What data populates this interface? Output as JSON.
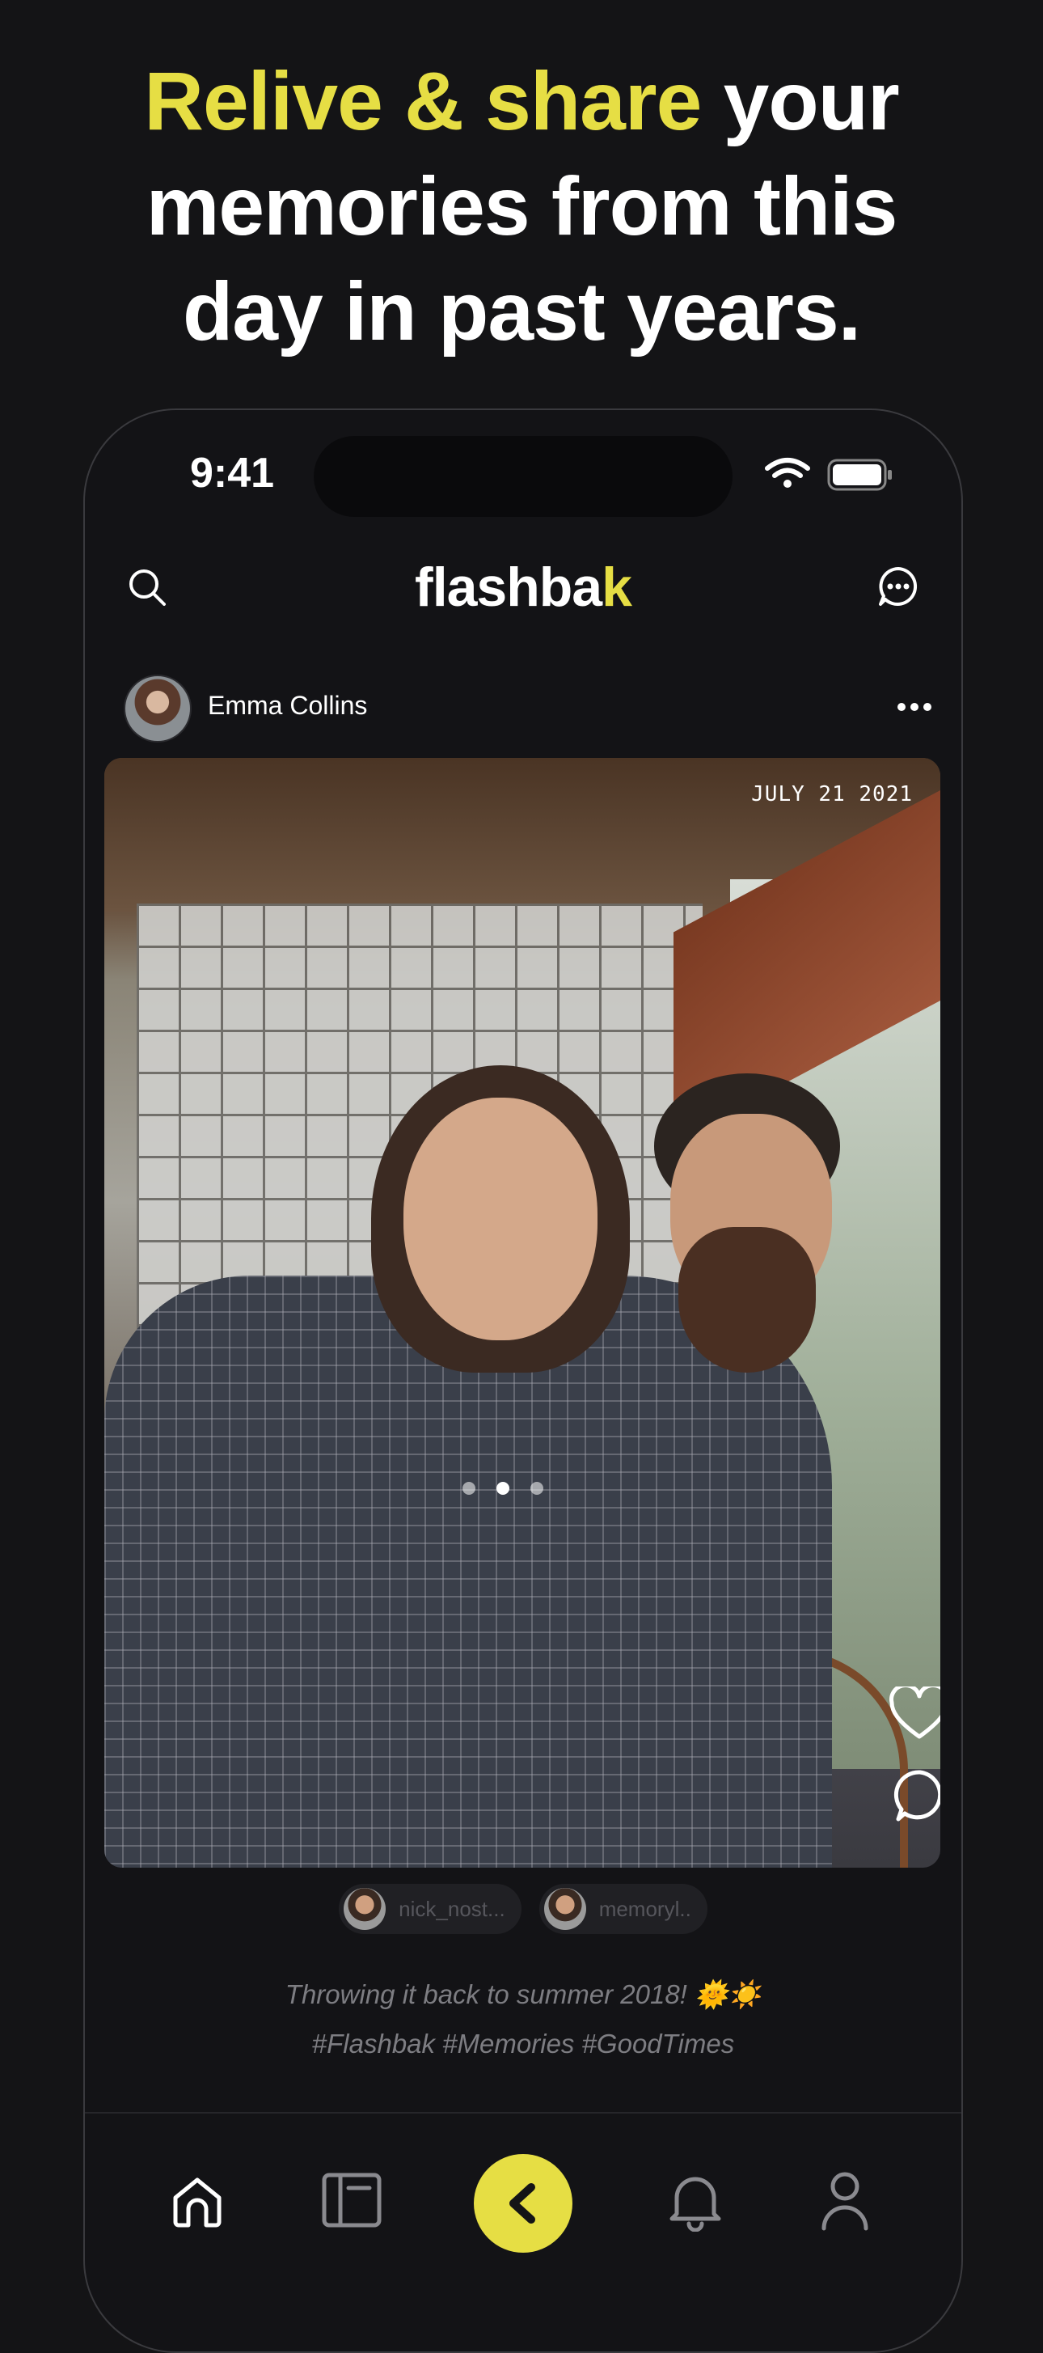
{
  "headline": {
    "highlight": "Relive & share",
    "rest_line1": " your",
    "line2": "memories from this",
    "line3": "day in past years."
  },
  "status_bar": {
    "time": "9:41"
  },
  "app": {
    "logo_main": "flashba",
    "logo_accent": "k",
    "accent_color": "#e6de44"
  },
  "post": {
    "username": "Emma Collins",
    "date": "JULY 21 2021",
    "carousel": {
      "count": 3,
      "active_index": 1
    },
    "tagged_users": [
      "nick_nost...",
      "memoryl.."
    ],
    "caption_line1": "Throwing it back to summer 2018! 🌞☀️",
    "caption_line2": "#Flashbak #Memories #GoodTimes"
  },
  "icons": {
    "top_left": "search-icon",
    "top_right": "chat-icon",
    "post_menu": "more-dots-icon",
    "photo_actions": [
      "heart-icon",
      "comment-icon"
    ],
    "nav": [
      "home-icon",
      "journal-icon",
      "flashbak-icon",
      "bell-icon",
      "profile-icon"
    ]
  }
}
